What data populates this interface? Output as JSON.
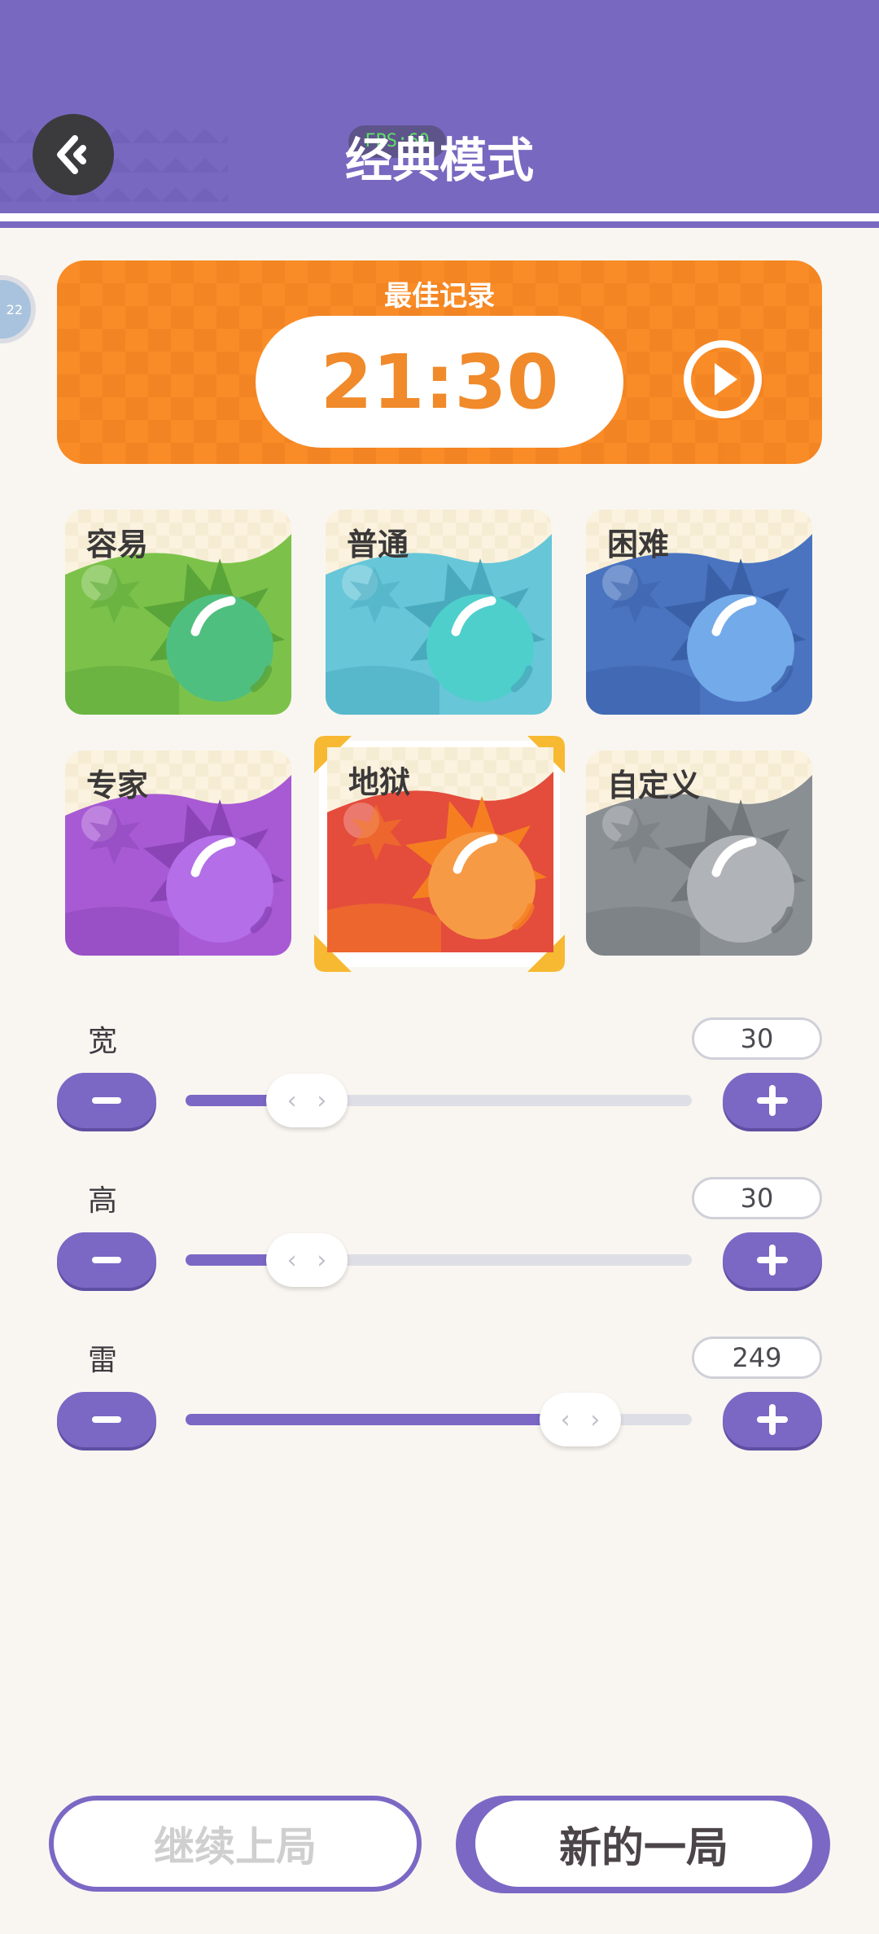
{
  "header": {
    "title": "经典模式",
    "fps_badge": "FPS:60"
  },
  "edge_avatar": {
    "text": "22"
  },
  "best_record": {
    "label": "最佳记录",
    "time": "21:30"
  },
  "modes": [
    {
      "label": "容易",
      "colors": {
        "bg": "#7cc24a",
        "sun": "#4fbf80",
        "dark": "#5aa53a"
      }
    },
    {
      "label": "普通",
      "colors": {
        "bg": "#67c6d8",
        "sun": "#4ecfcc",
        "dark": "#4aaabd"
      }
    },
    {
      "label": "困难",
      "colors": {
        "bg": "#4a74c0",
        "sun": "#72aaea",
        "dark": "#3a60a8"
      }
    },
    {
      "label": "专家",
      "colors": {
        "bg": "#a85ad4",
        "sun": "#b36ee8",
        "dark": "#8a44b6"
      }
    },
    {
      "label": "地狱",
      "colors": {
        "bg": "#e44c3c",
        "sun": "#f79a45",
        "dark": "#f57f20"
      },
      "selected": true
    },
    {
      "label": "自定义",
      "colors": {
        "bg": "#8a8f94",
        "sun": "#b0b4b8",
        "dark": "#72777c"
      }
    }
  ],
  "settings": [
    {
      "label": "宽",
      "value": "30",
      "fraction": 0.24
    },
    {
      "label": "高",
      "value": "30",
      "fraction": 0.24
    },
    {
      "label": "雷",
      "value": "249",
      "fraction": 0.78
    }
  ],
  "thumb_glyph": "‹ ›",
  "buttons": {
    "continue": "继续上局",
    "new_game": "新的一局"
  },
  "colors": {
    "header": "#7968c0",
    "accent": "#7b68c4",
    "record": "#f98c27",
    "selected_frame": "#f7b931"
  }
}
